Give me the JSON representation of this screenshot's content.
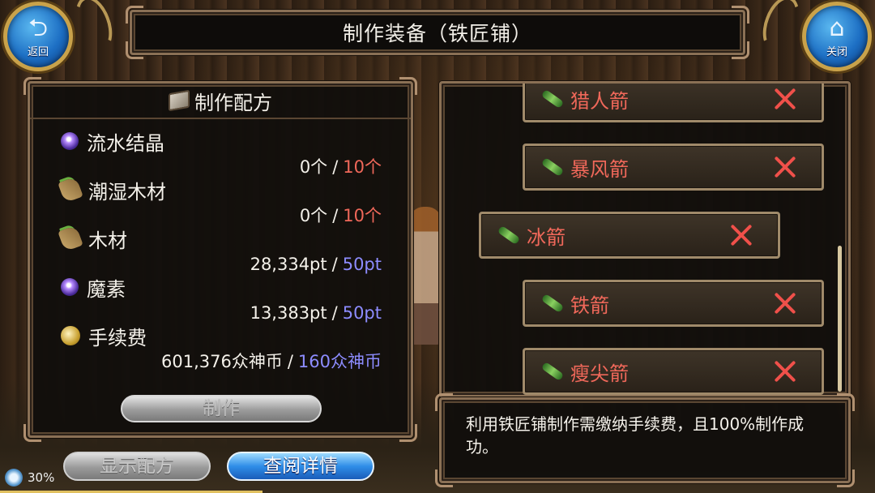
{
  "header": {
    "title": "制作装备（铁匠铺）"
  },
  "nav": {
    "back_label": "返回",
    "close_label": "关闭"
  },
  "recipe": {
    "title": "制作配方",
    "materials": [
      {
        "name": "流水结晶",
        "icon": "orb-icon",
        "have": "0个",
        "need": "10个",
        "need_color": "red"
      },
      {
        "name": "潮湿木材",
        "icon": "wood-icon",
        "have": "0个",
        "need": "10个",
        "need_color": "red"
      },
      {
        "name": "木材",
        "icon": "wood-icon",
        "have": "28,334pt",
        "need": "50pt",
        "need_color": "blue"
      },
      {
        "name": "魔素",
        "icon": "orb-icon",
        "have": "13,383pt",
        "need": "50pt",
        "need_color": "blue"
      },
      {
        "name": "手续费",
        "icon": "coin-icon",
        "have": "601,376众神币",
        "need": "160众神币",
        "need_color": "blue"
      }
    ],
    "separator": "/",
    "make_label": "制作"
  },
  "buttons": {
    "show_recipe": "显示配方",
    "view_details": "查阅详情"
  },
  "items": [
    {
      "name": "猎人箭",
      "selected": false
    },
    {
      "name": "暴风箭",
      "selected": false
    },
    {
      "name": "冰箭",
      "selected": true
    },
    {
      "name": "铁箭",
      "selected": false
    },
    {
      "name": "瘦尖箭",
      "selected": false
    }
  ],
  "info": {
    "text": "利用铁匠铺制作需缴纳手续费，且100%制作成功。"
  },
  "status": {
    "loading_percent": "30%",
    "loading_fraction": 0.3
  },
  "colors": {
    "need_red": "#f0685a",
    "need_blue": "#8d8cff",
    "frame": "#8a7055",
    "button_blue": "#2f8ee8"
  }
}
